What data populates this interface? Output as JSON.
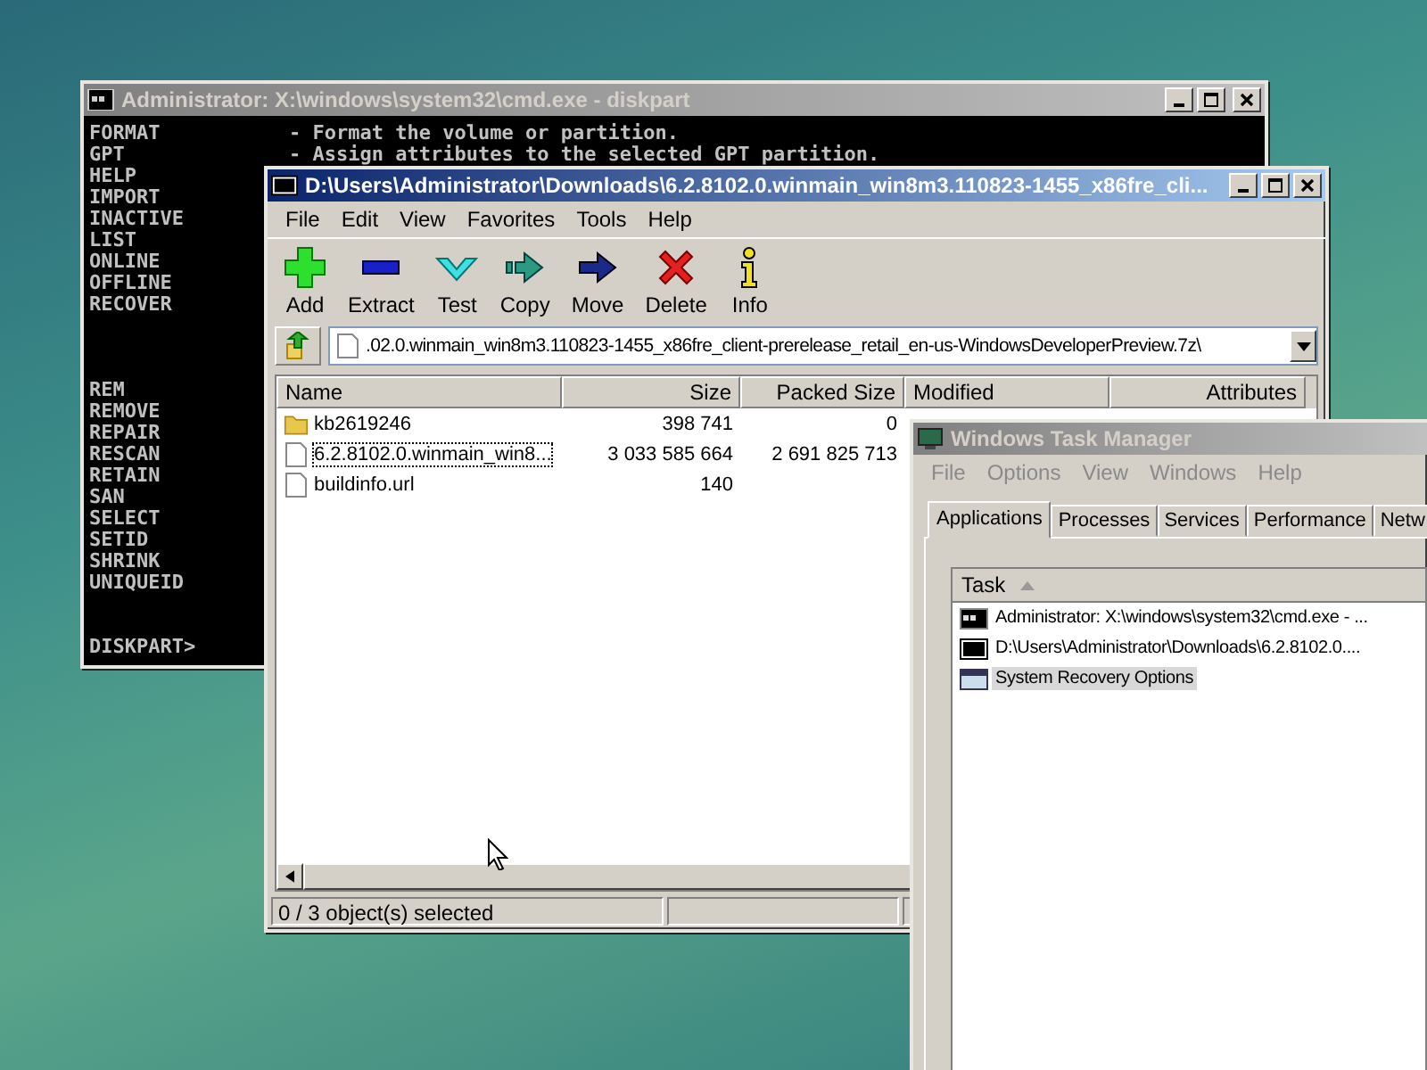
{
  "cmd_window": {
    "title": "Administrator: X:\\windows\\system32\\cmd.exe - diskpart",
    "active": false,
    "lines": [
      {
        "command": "FORMAT",
        "description": "- Format the volume or partition."
      },
      {
        "command": "GPT",
        "description": "- Assign attributes to the selected GPT partition."
      }
    ],
    "command_groups": [
      [
        "HELP",
        "IMPORT",
        "INACTIVE",
        "LIST",
        "ONLINE",
        "OFFLINE",
        "RECOVER"
      ],
      [
        "REM",
        "REMOVE",
        "REPAIR",
        "RESCAN",
        "RETAIN",
        "SAN",
        "SELECT",
        "SETID",
        "SHRINK",
        "UNIQUEID"
      ]
    ],
    "prompt": "DISKPART>"
  },
  "archive_window": {
    "title": "D:\\Users\\Administrator\\Downloads\\6.2.8102.0.winmain_win8m3.110823-1455_x86fre_cli...",
    "active": true,
    "menu": [
      "File",
      "Edit",
      "View",
      "Favorites",
      "Tools",
      "Help"
    ],
    "toolbar": [
      {
        "kind": "add",
        "label": "Add"
      },
      {
        "kind": "extract",
        "label": "Extract"
      },
      {
        "kind": "test",
        "label": "Test"
      },
      {
        "kind": "copy",
        "label": "Copy"
      },
      {
        "kind": "move",
        "label": "Move"
      },
      {
        "kind": "delete",
        "label": "Delete"
      },
      {
        "kind": "info",
        "label": "Info"
      }
    ],
    "address": ".02.0.winmain_win8m3.110823-1455_x86fre_client-prerelease_retail_en-us-WindowsDeveloperPreview.7z\\",
    "columns": [
      "Name",
      "Size",
      "Packed Size",
      "Modified",
      "Attributes"
    ],
    "files": [
      {
        "kind": "folder",
        "name": "kb2619246",
        "size": "398 741",
        "packed_size": "0",
        "focused": false
      },
      {
        "kind": "file",
        "name": "6.2.8102.0.winmain_win8...",
        "size": "3 033 585 664",
        "packed_size": "2 691 825 713",
        "focused": true
      },
      {
        "kind": "file",
        "name": "buildinfo.url",
        "size": "140",
        "focused": false
      }
    ],
    "status_bar": "0 / 3 object(s) selected"
  },
  "task_manager": {
    "title": "Windows Task Manager",
    "active": false,
    "menu": [
      "File",
      "Options",
      "View",
      "Windows",
      "Help"
    ],
    "tabs": [
      {
        "label": "Applications",
        "selected": true
      },
      {
        "label": "Processes",
        "selected": false
      },
      {
        "label": "Services",
        "selected": false
      },
      {
        "label": "Performance",
        "selected": false
      },
      {
        "label": "Netw",
        "selected": false
      }
    ],
    "task_column": "Task",
    "tasks": [
      {
        "kind": "console",
        "name": "Administrator: X:\\windows\\system32\\cmd.exe - ...",
        "selected": false
      },
      {
        "kind": "archiver",
        "name": "D:\\Users\\Administrator\\Downloads\\6.2.8102.0....",
        "selected": false
      },
      {
        "kind": "window",
        "name": "System Recovery Options",
        "selected": true
      }
    ]
  }
}
